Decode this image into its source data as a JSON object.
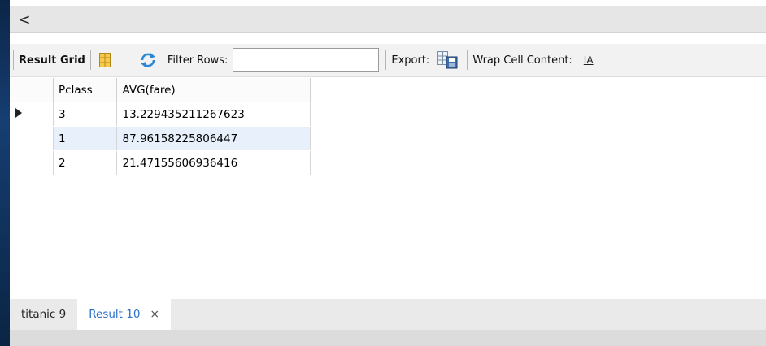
{
  "nav": {
    "scroll_left_glyph": "<"
  },
  "toolbar": {
    "result_grid_label": "Result Grid",
    "filter_rows_label": "Filter Rows:",
    "filter_value": "",
    "export_label": "Export:",
    "wrap_label": "Wrap Cell Content:",
    "wrap_icon_glyph": "IA"
  },
  "grid": {
    "columns": [
      "Pclass",
      "AVG(fare)"
    ],
    "rows": [
      {
        "pclass": "3",
        "avg_fare": "13.229435211267623"
      },
      {
        "pclass": "1",
        "avg_fare": "87.96158225806447"
      },
      {
        "pclass": "2",
        "avg_fare": "21.47155606936416"
      }
    ]
  },
  "tabs": [
    {
      "label": "titanic 9"
    },
    {
      "label": "Result 10",
      "close_glyph": "×"
    }
  ],
  "colors": {
    "accent": "#2a6fc8",
    "highlight": "#e8f1fb"
  }
}
